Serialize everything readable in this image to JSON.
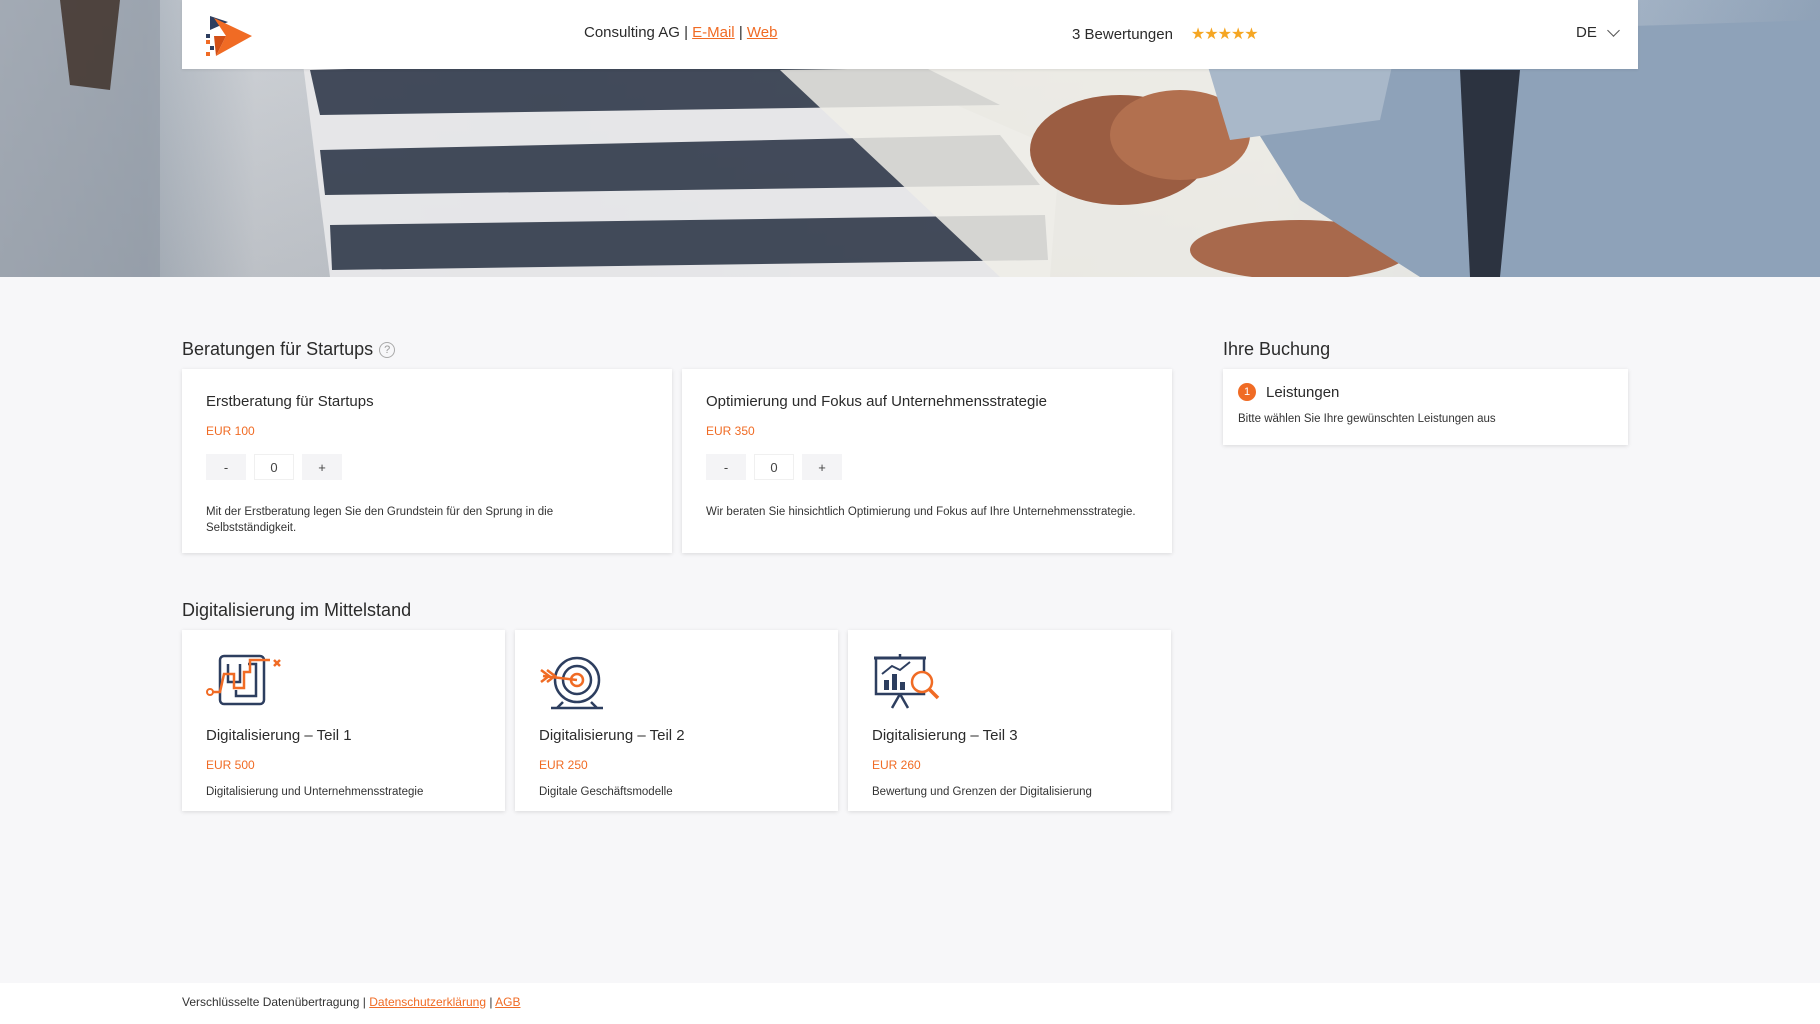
{
  "header": {
    "company": "Consulting AG",
    "email_link": "E-Mail",
    "web_link": "Web",
    "separator": "|",
    "reviews": "3 Bewertungen",
    "stars": "★★★★★",
    "language": "DE"
  },
  "startups": {
    "title": "Beratungen für Startups",
    "help": "?",
    "cards": [
      {
        "title": "Erstberatung für Startups",
        "price": "EUR 100",
        "minus": "-",
        "qty": "0",
        "plus": "+",
        "description": "Mit der Erstberatung legen Sie den Grundstein für den Sprung in die Selbstständigkeit."
      },
      {
        "title": "Optimierung und Fokus auf Unternehmensstrategie",
        "price": "EUR 350",
        "minus": "-",
        "qty": "0",
        "plus": "+",
        "description": "Wir beraten Sie hinsichtlich Optimierung und Fokus auf Ihre Unternehmensstrategie."
      }
    ]
  },
  "digital": {
    "title": "Digitalisierung im Mittelstand",
    "cards": [
      {
        "icon": "maze-icon",
        "title": "Digitalisierung – Teil 1",
        "price": "EUR 500",
        "description": "Digitalisierung und Unternehmensstrategie"
      },
      {
        "icon": "target-icon",
        "title": "Digitalisierung – Teil 2",
        "price": "EUR 250",
        "description": "Digitale Geschäftsmodelle"
      },
      {
        "icon": "presentation-chart-icon",
        "title": "Digitalisierung – Teil 3",
        "price": "EUR 260",
        "description": "Bewertung und Grenzen der Digitalisierung"
      }
    ]
  },
  "booking": {
    "title": "Ihre Buchung",
    "step_number": "1",
    "step_label": "Leistungen",
    "hint": "Bitte wählen Sie Ihre gewünschten Leistungen aus"
  },
  "footer": {
    "text": "Verschlüsselte Datenübertragung",
    "separator": "|",
    "privacy_link": "Datenschutzerklärung",
    "terms_link": "AGB"
  },
  "colors": {
    "accent": "#f06b24",
    "star": "#f5a623",
    "navy": "#2d3e5f"
  }
}
